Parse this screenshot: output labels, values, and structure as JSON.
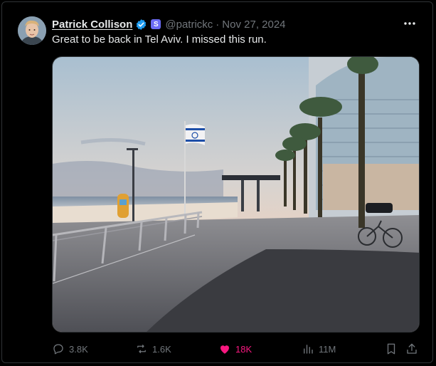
{
  "tweet": {
    "author_name": "Patrick Collison",
    "handle": "@patrickc",
    "separator": "·",
    "date": "Nov 27, 2024",
    "affiliate_badge": "S",
    "text": "Great to be back in Tel Aviv. I missed this run."
  },
  "stats": {
    "replies": "3.8K",
    "reposts": "1.6K",
    "likes": "18K",
    "views": "11M"
  },
  "icons": {
    "verified": "verified-badge-icon",
    "more": "more-options-icon",
    "reply": "reply-icon",
    "repost": "repost-icon",
    "like": "heart-icon",
    "views": "views-chart-icon",
    "bookmark": "bookmark-icon",
    "share": "share-icon"
  },
  "colors": {
    "background": "#000000",
    "text": "#e7e9ea",
    "muted": "#71767b",
    "verified": "#1d9bf0",
    "like": "#f91880",
    "affiliate": "#6b6bf5"
  }
}
